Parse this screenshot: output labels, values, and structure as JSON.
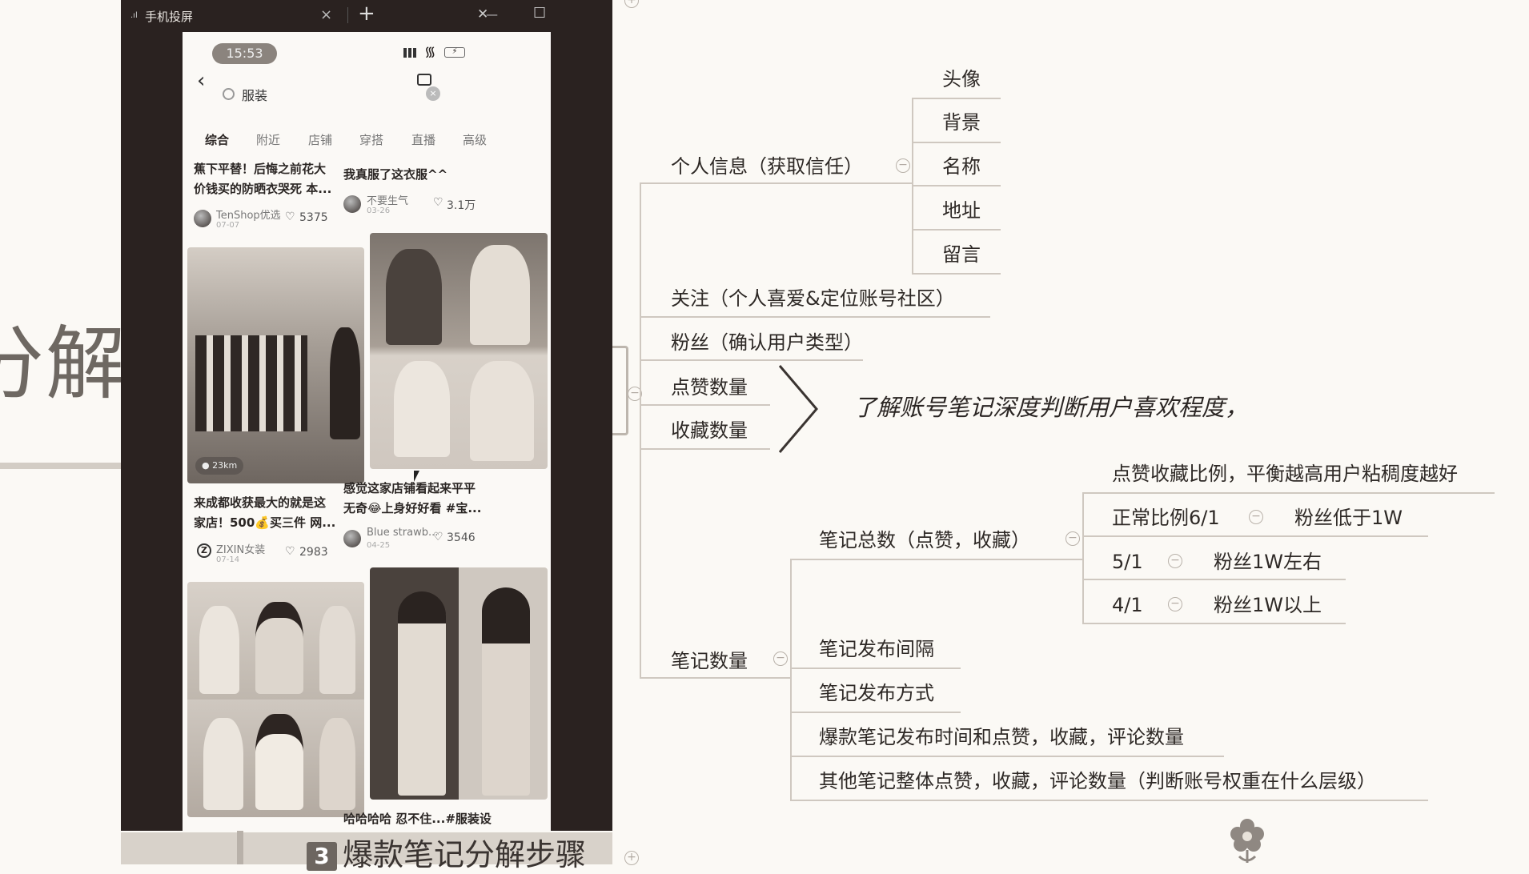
{
  "background": {
    "big_text": "分解",
    "section_number": "3",
    "section_title": "爆款笔记分解步骤"
  },
  "window": {
    "title": "手机投屏",
    "close_tab": "×",
    "new_tab": "+",
    "minimize": "—",
    "maximize": "☐",
    "close": "✕"
  },
  "phone": {
    "time": "15:53",
    "search": {
      "query": "服装"
    },
    "tabs": [
      "综合",
      "附近",
      "店铺",
      "穿搭",
      "直播",
      "高级"
    ],
    "cards": [
      {
        "title_lines": [
          "蕉下平替！后悔之前花大",
          "价钱买的防晒衣哭死 本..."
        ],
        "author": "TenShop优选",
        "date": "07-07",
        "likes": "5375"
      },
      {
        "title_lines": [
          "我真服了这衣服^^"
        ],
        "author": "不要生气",
        "date": "03-26",
        "likes": "3.1万"
      },
      {
        "badge": "23km",
        "title_lines": [
          "来成都收获最大的就是这",
          "家店！500💰买三件 网..."
        ],
        "author": "ZIXIN女装",
        "date": "07-14",
        "likes": "2983"
      },
      {
        "title_lines": [
          "感觉这家店铺看起来平平",
          "无奇😂上身好好看 #宝..."
        ],
        "author": "Blue strawb...",
        "date": "04-25",
        "likes": "3546"
      },
      {
        "title_lines": [
          "哈哈哈哈 忍不住...#服装设"
        ]
      }
    ]
  },
  "mindmap": {
    "personal_info": "个人信息（获取信任）",
    "personal_children": [
      "头像",
      "背景",
      "名称",
      "地址",
      "留言"
    ],
    "follow": "关注（个人喜爱&定位账号社区）",
    "fans": "粉丝（确认用户类型）",
    "likes_count": "点赞数量",
    "favorites_count": "收藏数量",
    "annotation": "了解账号笔记深度判断用户喜欢程度，",
    "notes_count": "笔记数量",
    "notes_total": "笔记总数（点赞，收藏）",
    "ratio_title": "点赞收藏比例，平衡越高用户粘稠度越好",
    "ratios": [
      {
        "ratio": "正常比例6/1",
        "fans": "粉丝低于1W"
      },
      {
        "ratio": "5/1",
        "fans": "粉丝1W左右"
      },
      {
        "ratio": "4/1",
        "fans": "粉丝1W以上"
      }
    ],
    "notes_children": [
      "笔记发布间隔",
      "笔记发布方式",
      "爆款笔记发布时间和点赞，收藏，评论数量",
      "其他笔记整体点赞，收藏，评论数量（判断账号权重在什么层级）"
    ],
    "collapse_symbol": "−",
    "expand_symbol": "+"
  }
}
